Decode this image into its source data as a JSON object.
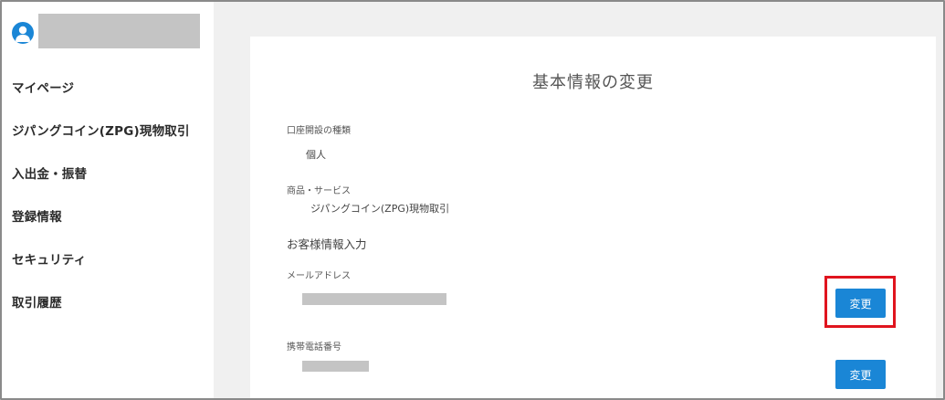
{
  "sidebar": {
    "items": [
      {
        "label": "マイページ"
      },
      {
        "label": "ジパングコイン(ZPG)現物取引"
      },
      {
        "label": "入出金・振替"
      },
      {
        "label": "登録情報"
      },
      {
        "label": "セキュリティ"
      },
      {
        "label": "取引履歴"
      }
    ]
  },
  "main": {
    "title": "基本情報の変更",
    "account_type": {
      "label": "口座開設の種類",
      "value": "個人"
    },
    "service": {
      "label": "商品・サービス",
      "value": "ジパングコイン(ZPG)現物取引"
    },
    "customer_section": "お客様情報入力",
    "email": {
      "label": "メールアドレス",
      "button": "変更"
    },
    "phone": {
      "label": "携帯電話番号",
      "button": "変更"
    }
  },
  "colors": {
    "accent": "#1a86d6",
    "highlight": "#e0141e",
    "placeholder": "#c4c4c4"
  }
}
